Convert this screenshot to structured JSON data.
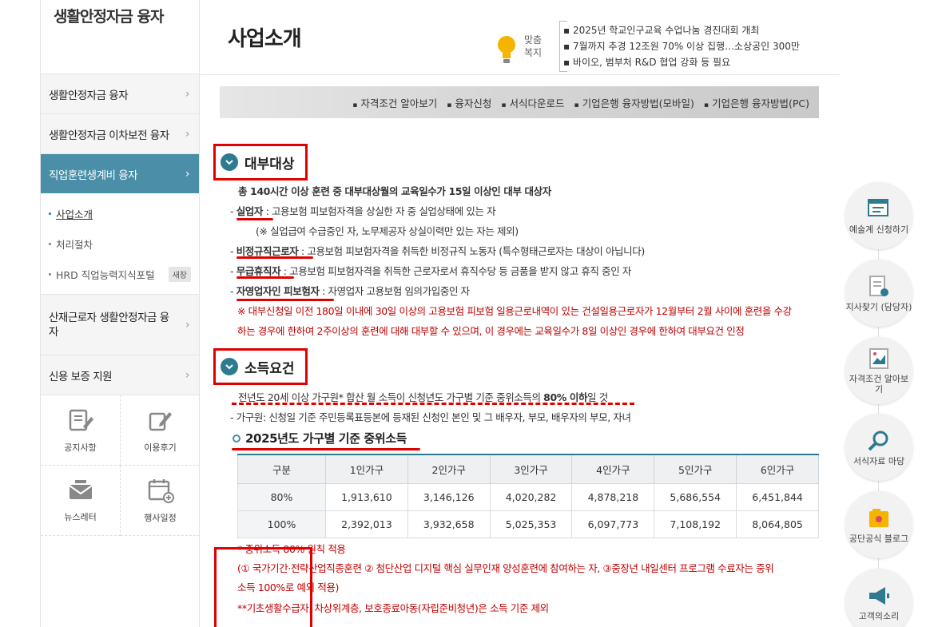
{
  "sidebar": {
    "title": "생활안정자금 융자",
    "menu": [
      "생활안정자금 융자",
      "생활안정자금 이차보전 융자",
      "직업훈련생계비 융자"
    ],
    "sub": [
      "사업소개",
      "처리절차",
      "HRD 직업능력지식포털"
    ],
    "new_badge": "새창",
    "menu2": [
      "산재근로자 생활안정자금 융자",
      "신용 보증 지원"
    ],
    "chevron": "›",
    "quick": [
      {
        "label": "공지사항",
        "icon": "notice-icon"
      },
      {
        "label": "이용후기",
        "icon": "review-icon"
      },
      {
        "label": "뉴스레터",
        "icon": "newsletter-icon"
      },
      {
        "label": "행사일정",
        "icon": "calendar-icon"
      }
    ]
  },
  "header": {
    "title": "사업소개",
    "news_label": "맞춤 복지",
    "news": [
      "▪ 2025년 학교인구교육 수업나눔 경진대회 개최",
      "▪ 7월까지 추경 12조원 70% 이상 집행…소상공인 300만",
      "▪ 바이오, 범부처 R&D 협업 강화 등 필요"
    ]
  },
  "tabs": [
    "자격조건 알아보기",
    "융자신청",
    "서식다운로드",
    "기업은행 융자방법(모바일)",
    "기업은행 융자방법(PC)"
  ],
  "section1": {
    "title": "대부대상",
    "intro": "총 140시간 이상 훈련 중 대부대상월의 교육일수가 15일 이상인 대부 대상자",
    "items": [
      {
        "term": "실업자",
        "desc": " : 고용보험 피보험자격을 상실한 자 중 실업상태에 있는 자"
      },
      {
        "note": "(※ 실업급여 수급중인 자, 노무제공자 상실이력만 있는 자는 제외)"
      },
      {
        "term": "비정규직근로자",
        "desc": " : 고용보험 피보험자격을 취득한 비정규직 노동자 (특수형태근로자는 대상이 아닙니다)"
      },
      {
        "term": "무급휴직자",
        "desc": " : 고용보험 피보험자격을 취득한 근로자로서 휴직수당 등 금품을 받지 않고 휴직 중인 자"
      },
      {
        "term": "자영업자인 피보험자",
        "desc": " : 자영업자 고용보험 임의가입중인 자"
      }
    ],
    "red_note": [
      "※ 대부신청일 이전 180일 이내에 30일 이상의 고용보험 피보험 일용근로내역이 있는 건설일용근로자가 12월부터 2월 사이에 훈련을 수강",
      "하는 경우에 한하여 2주이상의 훈련에 대해 대부할 수 있으며, 이 경우에는 교육일수가 8일 이상인 경우에 한하여 대부요건 인정"
    ]
  },
  "section2": {
    "title": "소득요건",
    "line1a": "전년도 20세 이상 가구원* 합산 월 소득이 신청년도 가구별 기준 중위소득의 ",
    "line1b": "80% 이하",
    "line1c": "일 것",
    "line2": "- 가구원: 신청일 기준 주민등록표등본에 등재된 신청인 본인 및 그 배우자, 부모, 배우자의 부모, 자녀",
    "subtitle": "2025년도 가구별 기준 중위소득",
    "table": {
      "headers": [
        "구분",
        "1인가구",
        "2인가구",
        "3인가구",
        "4인가구",
        "5인가구",
        "6인가구"
      ],
      "rows": [
        [
          "80%",
          "1,913,610",
          "3,146,126",
          "4,020,282",
          "4,878,218",
          "5,686,554",
          "6,451,844"
        ],
        [
          "100%",
          "2,392,013",
          "3,932,658",
          "5,025,353",
          "6,097,773",
          "7,108,192",
          "8,064,805"
        ]
      ]
    },
    "notes": [
      "* 중위소득 80% 원칙 적용",
      "(① 국가기간·전략산업직종훈련 ② 첨단산업 디지털 핵심 실무인재 양성훈련에 참여하는 자, ③중장년 내일센터 프로그램 수료자는 중위",
      "소득 100%로 예외 적용)",
      "**기초생활수급자, 차상위계층, 보호종료아동(자립준비청년)은 소득 기준 제외"
    ]
  },
  "float": [
    {
      "label": "예술계 신청하기",
      "icon": "art-apply-icon"
    },
    {
      "label": "지사찾기 (담당자)",
      "icon": "branch-find-icon"
    },
    {
      "label": "자격조건 알아보기",
      "icon": "eligibility-icon"
    },
    {
      "label": "서식자료 마당",
      "icon": "form-search-icon"
    },
    {
      "label": "공단공식 블로그",
      "icon": "blog-icon"
    },
    {
      "label": "고객의소리",
      "icon": "megaphone-icon"
    }
  ],
  "colors": {
    "accent": "#4a8fa7",
    "section_circle": "#2e7a8e",
    "highlight": "#e10000",
    "note_red": "#c00000"
  }
}
